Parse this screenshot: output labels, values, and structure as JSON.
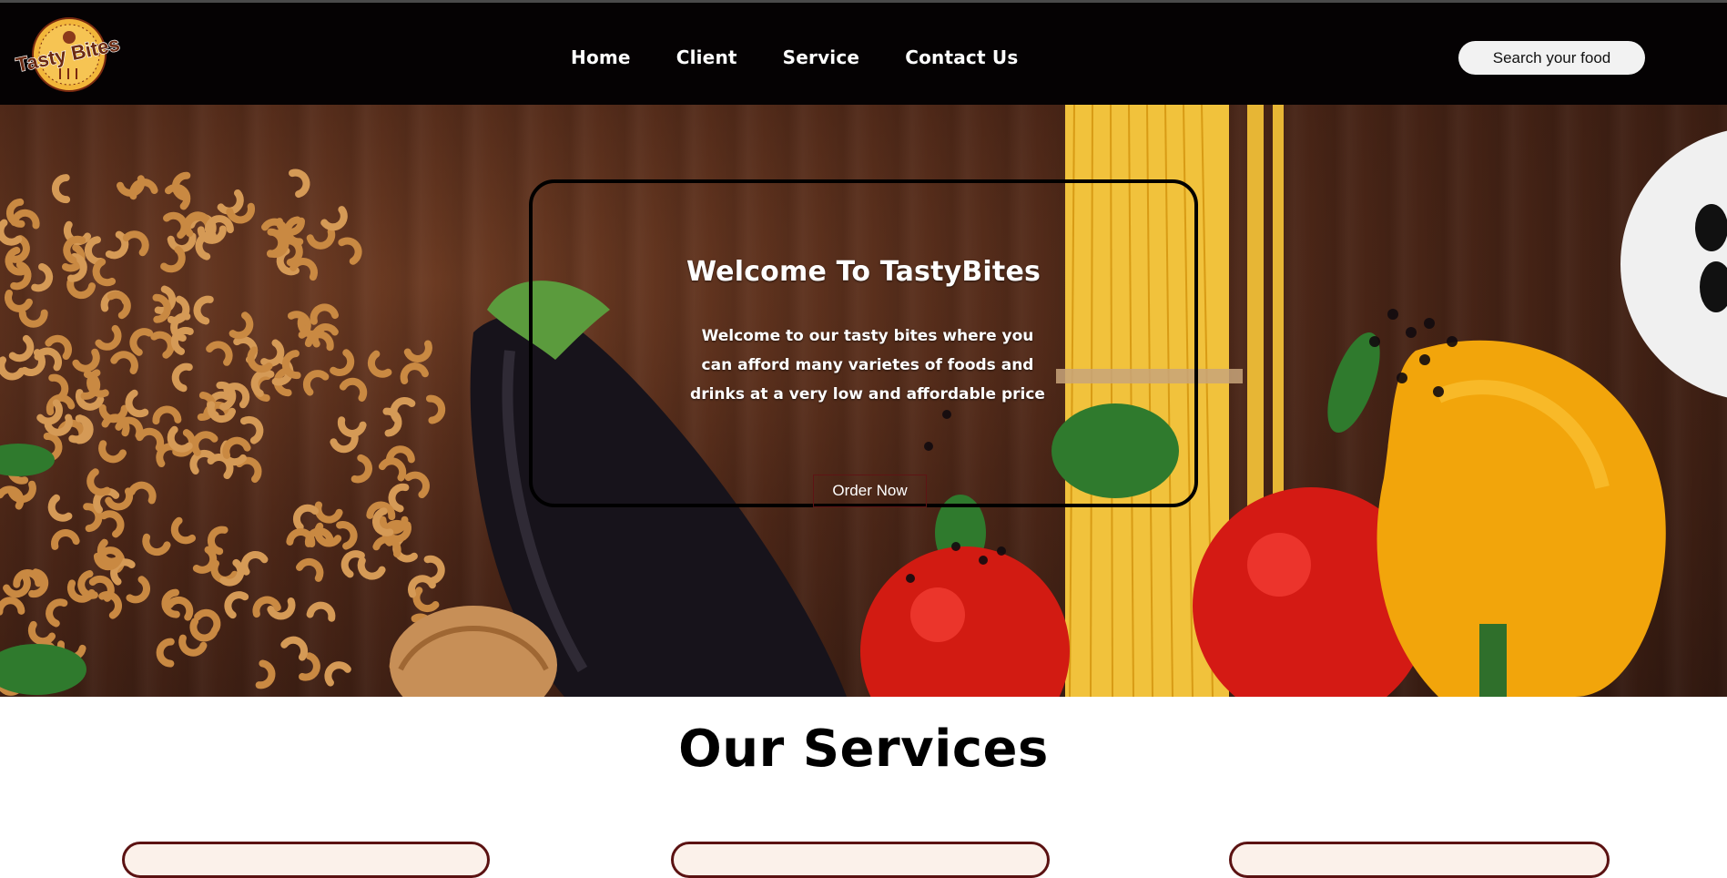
{
  "brand": {
    "logo_text": "Tasty Bites",
    "colors": {
      "logo_ring": "#f2b63a",
      "logo_inner": "#f6c453",
      "logo_text": "#6b2a12"
    }
  },
  "nav": {
    "items": [
      {
        "label": "Home"
      },
      {
        "label": "Client"
      },
      {
        "label": "Service"
      },
      {
        "label": "Contact Us"
      }
    ]
  },
  "search": {
    "placeholder": "Search your food"
  },
  "hero": {
    "title": "Welcome To TastyBites",
    "text": "Welcome to our tasty bites where you can afford many varietes of foods and drinks at a very low and affordable price",
    "button_label": "Order Now"
  },
  "services": {
    "title": "Our Services"
  },
  "theme": {
    "navbar_bg": "#050203",
    "accent": "#5b1212",
    "card_bg": "#fbf1ea"
  }
}
